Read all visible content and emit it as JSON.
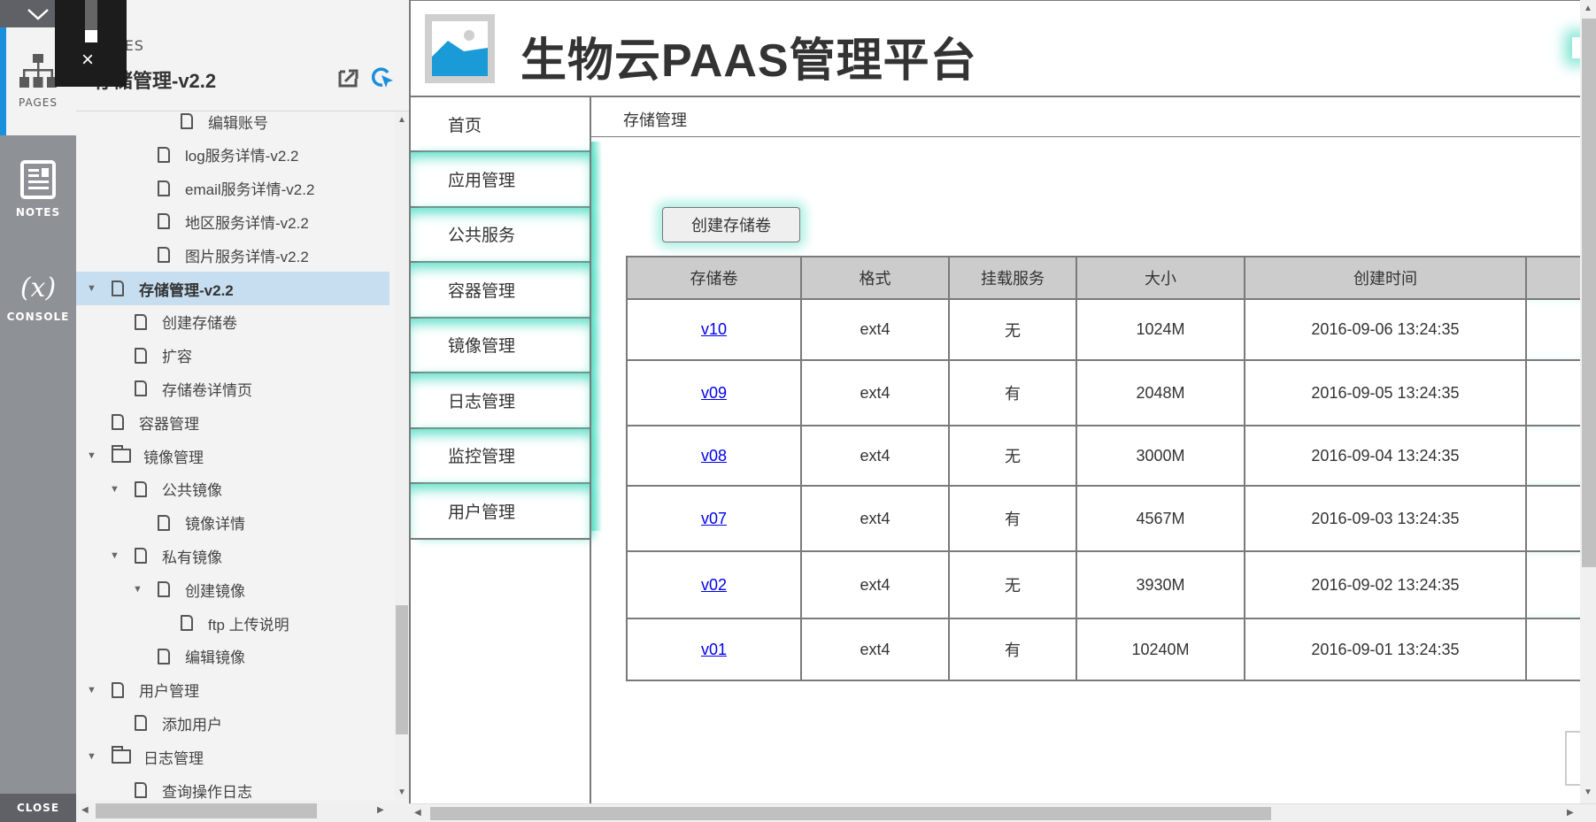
{
  "rail": {
    "tabs": [
      {
        "label": "PAGES",
        "icon": "sitemap-icon",
        "active": true
      },
      {
        "label": "NOTES",
        "icon": "notes-icon",
        "active": false
      },
      {
        "label": "CONSOLE",
        "icon": "variable-x-icon",
        "glyph": "(x)",
        "active": false
      }
    ],
    "close_label": "CLOSE"
  },
  "overlay": {
    "close_glyph": "×"
  },
  "panel": {
    "section_label": "PAGES",
    "title": "存储管理-v2.2",
    "tree": [
      {
        "label": "编辑账号",
        "level": 4,
        "type": "page",
        "caret": false
      },
      {
        "label": "log服务详情-v2.2",
        "level": 3,
        "type": "page",
        "caret": false
      },
      {
        "label": "email服务详情-v2.2",
        "level": 3,
        "type": "page",
        "caret": false
      },
      {
        "label": "地区服务详情-v2.2",
        "level": 3,
        "type": "page",
        "caret": false
      },
      {
        "label": "图片服务详情-v2.2",
        "level": 3,
        "type": "page",
        "caret": false
      },
      {
        "label": "存储管理-v2.2",
        "level": 1,
        "type": "page",
        "caret": true,
        "selected": true
      },
      {
        "label": "创建存储卷",
        "level": 2,
        "type": "page",
        "caret": false
      },
      {
        "label": "扩容",
        "level": 2,
        "type": "page",
        "caret": false
      },
      {
        "label": "存储卷详情页",
        "level": 2,
        "type": "page",
        "caret": false
      },
      {
        "label": "容器管理",
        "level": 1,
        "type": "page",
        "caret": false
      },
      {
        "label": "镜像管理",
        "level": 1,
        "type": "folder",
        "caret": true
      },
      {
        "label": "公共镜像",
        "level": 2,
        "type": "page",
        "caret": true
      },
      {
        "label": "镜像详情",
        "level": 3,
        "type": "page",
        "caret": false
      },
      {
        "label": "私有镜像",
        "level": 2,
        "type": "page",
        "caret": true
      },
      {
        "label": "创建镜像",
        "level": 3,
        "type": "page",
        "caret": true
      },
      {
        "label": "ftp 上传说明",
        "level": 4,
        "type": "page",
        "caret": false
      },
      {
        "label": "编辑镜像",
        "level": 3,
        "type": "page",
        "caret": false
      },
      {
        "label": "用户管理",
        "level": 1,
        "type": "page",
        "caret": true
      },
      {
        "label": "添加用户",
        "level": 2,
        "type": "page",
        "caret": false
      },
      {
        "label": "日志管理",
        "level": 1,
        "type": "folder",
        "caret": true
      },
      {
        "label": "查询操作日志",
        "level": 2,
        "type": "page",
        "caret": false
      }
    ]
  },
  "app": {
    "title": "生物云PAAS管理平台",
    "breadcrumb": "存储管理",
    "nav": [
      "首页",
      "应用管理",
      "公共服务",
      "容器管理",
      "镜像管理",
      "日志管理",
      "监控管理",
      "用户管理"
    ],
    "create_button": "创建存储卷",
    "table": {
      "headers": [
        "存储卷",
        "格式",
        "挂载服务",
        "大小",
        "创建时间",
        ""
      ],
      "rows": [
        {
          "name": "v10",
          "format": "ext4",
          "mounted": "无",
          "size": "1024M",
          "created": "2016-09-06 13:24:35"
        },
        {
          "name": "v09",
          "format": "ext4",
          "mounted": "有",
          "size": "2048M",
          "created": "2016-09-05 13:24:35"
        },
        {
          "name": "v08",
          "format": "ext4",
          "mounted": "无",
          "size": "3000M",
          "created": "2016-09-04 13:24:35"
        },
        {
          "name": "v07",
          "format": "ext4",
          "mounted": "有",
          "size": "4567M",
          "created": "2016-09-03 13:24:35"
        },
        {
          "name": "v02",
          "format": "ext4",
          "mounted": "无",
          "size": "3930M",
          "created": "2016-09-02 13:24:35"
        },
        {
          "name": "v01",
          "format": "ext4",
          "mounted": "有",
          "size": "10240M",
          "created": "2016-09-01 13:24:35"
        }
      ]
    }
  },
  "colors": {
    "accent": "#1a8fdc",
    "glow": "#5fe0c8",
    "selected": "#c6def0",
    "link": "#0000ee"
  }
}
